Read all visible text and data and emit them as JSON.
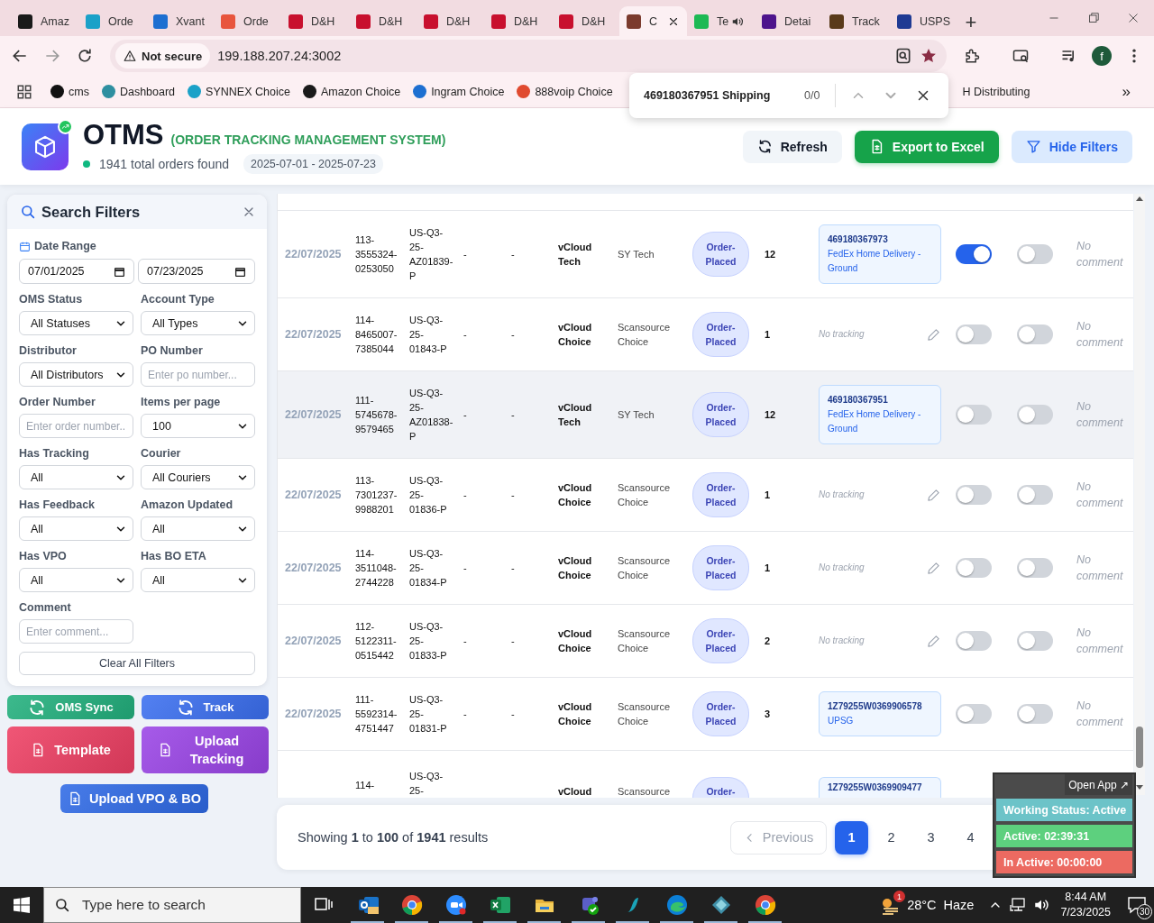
{
  "browser": {
    "tabs": [
      {
        "label": "Amaz",
        "color": "#1a1a1a",
        "selected": false,
        "audio": false
      },
      {
        "label": "Orde",
        "color": "#1ba1c8",
        "selected": false,
        "audio": false
      },
      {
        "label": "Xvant",
        "color": "#1d6fd1",
        "selected": false,
        "audio": false
      },
      {
        "label": "Orde",
        "color": "#e8553d",
        "selected": false,
        "audio": false
      },
      {
        "label": "D&H",
        "color": "#c8102e",
        "selected": false,
        "audio": false
      },
      {
        "label": "D&H",
        "color": "#c8102e",
        "selected": false,
        "audio": false
      },
      {
        "label": "D&H",
        "color": "#c8102e",
        "selected": false,
        "audio": false
      },
      {
        "label": "D&H",
        "color": "#c8102e",
        "selected": false,
        "audio": false
      },
      {
        "label": "D&H",
        "color": "#c8102e",
        "selected": false,
        "audio": false
      },
      {
        "label": "C",
        "color": "#7b3b2e",
        "selected": true,
        "audio": false
      },
      {
        "label": "Te",
        "color": "#1db954",
        "selected": false,
        "audio": true
      },
      {
        "label": "Detai",
        "color": "#4d148c",
        "selected": false,
        "audio": false
      },
      {
        "label": "Track",
        "color": "#5a3a1a",
        "selected": false,
        "audio": false
      },
      {
        "label": "USPS",
        "color": "#1f3a93",
        "selected": false,
        "audio": false
      }
    ],
    "new_tab": "+",
    "address": {
      "security": "Not secure",
      "url": "199.188.207.24:3002"
    },
    "profile": "f",
    "bookmarks": [
      {
        "label": "cms",
        "color": "#111111"
      },
      {
        "label": "Dashboard",
        "color": "#2e8fa0"
      },
      {
        "label": "SYNNEX Choice",
        "color": "#1ba1c8"
      },
      {
        "label": "Amazon Choice",
        "color": "#1a1a1a"
      },
      {
        "label": "Ingram Choice",
        "color": "#1d6fd1"
      },
      {
        "label": "888voip Choice",
        "color": "#e04a2f"
      }
    ],
    "partly_hidden_bookmark": "H Distributing",
    "more_bookmarks": "»"
  },
  "find_bar": {
    "query": "469180367951 Shipping",
    "count": "0/0"
  },
  "header": {
    "title": "OTMS",
    "subtitle": "(ORDER TRACKING MANAGEMENT SYSTEM)",
    "summary": "1941 total orders found",
    "date_range": "2025-07-01 - 2025-07-23",
    "buttons": [
      {
        "label": "Refresh",
        "kind": "refresh"
      },
      {
        "label": "Export to Excel",
        "kind": "export"
      },
      {
        "label": "Hide Filters",
        "kind": "filter"
      }
    ]
  },
  "filters": {
    "title": "Search Filters",
    "date_range": {
      "label": "Date Range",
      "from": "07/01/2025",
      "to": "07/23/2025"
    },
    "fields": [
      {
        "label": "OMS Status",
        "kind": "select",
        "value": "All Statuses"
      },
      {
        "label": "Account Type",
        "kind": "select",
        "value": "All Types"
      },
      {
        "label": "Distributor",
        "kind": "select",
        "value": "All Distributors"
      },
      {
        "label": "PO Number",
        "kind": "text",
        "placeholder": "Enter po number..."
      },
      {
        "label": "Order Number",
        "kind": "text",
        "placeholder": "Enter order number.."
      },
      {
        "label": "Items per page",
        "kind": "select",
        "value": "100"
      },
      {
        "label": "Has Tracking",
        "kind": "select",
        "value": "All"
      },
      {
        "label": "Courier",
        "kind": "select",
        "value": "All Couriers"
      },
      {
        "label": "Has Feedback",
        "kind": "select",
        "value": "All"
      },
      {
        "label": "Amazon Updated",
        "kind": "select",
        "value": "All"
      },
      {
        "label": "Has VPO",
        "kind": "select",
        "value": "All"
      },
      {
        "label": "Has BO ETA",
        "kind": "select",
        "value": "All"
      },
      {
        "label": "Comment",
        "kind": "text",
        "placeholder": "Enter comment..."
      }
    ],
    "clear_button": "Clear All Filters"
  },
  "actions": [
    {
      "label": "OMS Sync",
      "kind": "sync",
      "color": "#22b07d"
    },
    {
      "label": "Track",
      "kind": "sync",
      "color": "#3b6ff0"
    },
    {
      "label": "Template",
      "kind": "file",
      "color": "#ee3f63"
    },
    {
      "label": "Upload Tracking",
      "kind": "file",
      "color": "#9a44e6"
    },
    {
      "label": "Upload VPO & BO",
      "kind": "file",
      "color": "#2f6ae6"
    }
  ],
  "orders": {
    "rows": [
      {
        "date": "22/07/2025",
        "order_number": "113-3555324-0253050",
        "po_number": "US-Q3-25-AZ01839-P",
        "column_4": "-",
        "column_5": "-",
        "account": "vCloud Tech",
        "distributor": "SY Tech",
        "status": "Order-Placed",
        "column_9": "12",
        "tracking": {
          "kind": "label",
          "number": "469180367973",
          "courier": "FedEx Home Delivery - Ground"
        },
        "switches": [
          {
            "on": true
          },
          {
            "on": false
          }
        ],
        "comment": "No comment",
        "highlighted": false
      },
      {
        "date": "22/07/2025",
        "order_number": "114-8465007-7385044",
        "po_number": "US-Q3-25-01843-P",
        "column_4": "-",
        "column_5": "-",
        "account": "vCloud Choice",
        "distributor": "Scansource Choice",
        "status": "Order-Placed",
        "column_9": "1",
        "tracking": {
          "kind": "none",
          "text": "No tracking"
        },
        "switches": [
          {
            "on": false
          },
          {
            "on": false
          }
        ],
        "comment": "No comment",
        "highlighted": false
      },
      {
        "date": "22/07/2025",
        "order_number": "111-5745678-9579465",
        "po_number": "US-Q3-25-AZ01838-P",
        "column_4": "-",
        "column_5": "-",
        "account": "vCloud Tech",
        "distributor": "SY Tech",
        "status": "Order-Placed",
        "column_9": "12",
        "tracking": {
          "kind": "label",
          "number": "469180367951",
          "courier": "FedEx Home Delivery - Ground"
        },
        "switches": [
          {
            "on": false
          },
          {
            "on": false
          }
        ],
        "comment": "No comment",
        "highlighted": true
      },
      {
        "date": "22/07/2025",
        "order_number": "113-7301237-9988201",
        "po_number": "US-Q3-25-01836-P",
        "column_4": "-",
        "column_5": "-",
        "account": "vCloud Choice",
        "distributor": "Scansource Choice",
        "status": "Order-Placed",
        "column_9": "1",
        "tracking": {
          "kind": "none",
          "text": "No tracking"
        },
        "switches": [
          {
            "on": false
          },
          {
            "on": false
          }
        ],
        "comment": "No comment",
        "highlighted": false
      },
      {
        "date": "22/07/2025",
        "order_number": "114-3511048-2744228",
        "po_number": "US-Q3-25-01834-P",
        "column_4": "-",
        "column_5": "-",
        "account": "vCloud Choice",
        "distributor": "Scansource Choice",
        "status": "Order-Placed",
        "column_9": "1",
        "tracking": {
          "kind": "none",
          "text": "No tracking"
        },
        "switches": [
          {
            "on": false
          },
          {
            "on": false
          }
        ],
        "comment": "No comment",
        "highlighted": false
      },
      {
        "date": "22/07/2025",
        "order_number": "112-5122311-0515442",
        "po_number": "US-Q3-25-01833-P",
        "column_4": "-",
        "column_5": "-",
        "account": "vCloud Choice",
        "distributor": "Scansource Choice",
        "status": "Order-Placed",
        "column_9": "2",
        "tracking": {
          "kind": "none",
          "text": "No tracking"
        },
        "switches": [
          {
            "on": false
          },
          {
            "on": false
          }
        ],
        "comment": "No comment",
        "highlighted": false
      },
      {
        "date": "22/07/2025",
        "order_number": "111-5592314-4751447",
        "po_number": "US-Q3-25-01831-P",
        "column_4": "-",
        "column_5": "-",
        "account": "vCloud Choice",
        "distributor": "Scansource Choice",
        "status": "Order-Placed",
        "column_9": "3",
        "tracking": {
          "kind": "label",
          "number": "1Z79255W0369906578",
          "courier": "UPSG"
        },
        "switches": [
          {
            "on": false
          },
          {
            "on": false
          }
        ],
        "comment": "No comment",
        "highlighted": false
      }
    ],
    "partial_row": {
      "order_number": "114-",
      "po_number": "US-Q3-25-",
      "account": "vCloud",
      "distributor": "Scansource",
      "status": "Order-",
      "tracking_number": "1Z79255W0369909477"
    }
  },
  "pagination": {
    "summary": "Showing **1** to **100** of **1941** results",
    "previous": {
      "label": "Previous",
      "disabled": true
    },
    "pages": [
      {
        "label": "1",
        "selected": true
      },
      {
        "label": "2",
        "selected": false
      },
      {
        "label": "3",
        "selected": false
      },
      {
        "label": "4",
        "selected": false
      }
    ]
  },
  "status_widget": {
    "open_app": "Open App ↗",
    "working": "Working Status: Active",
    "active": "Active: 02:39:31",
    "inactive": "In Active: 00:00:00"
  },
  "taskbar": {
    "search_placeholder": "Type here to search",
    "apps": [
      {
        "kind": "outlook"
      },
      {
        "kind": "chrome"
      },
      {
        "kind": "zoom"
      },
      {
        "kind": "excel"
      },
      {
        "kind": "explorer"
      },
      {
        "kind": "teams"
      },
      {
        "kind": "wave"
      },
      {
        "kind": "edge"
      },
      {
        "kind": "diamond"
      },
      {
        "kind": "chrome"
      }
    ],
    "weather": {
      "badge": "1",
      "temperature": "28°C",
      "condition": "Haze"
    },
    "time": "8:44 AM",
    "date": "7/23/2025",
    "notifications": "30"
  }
}
